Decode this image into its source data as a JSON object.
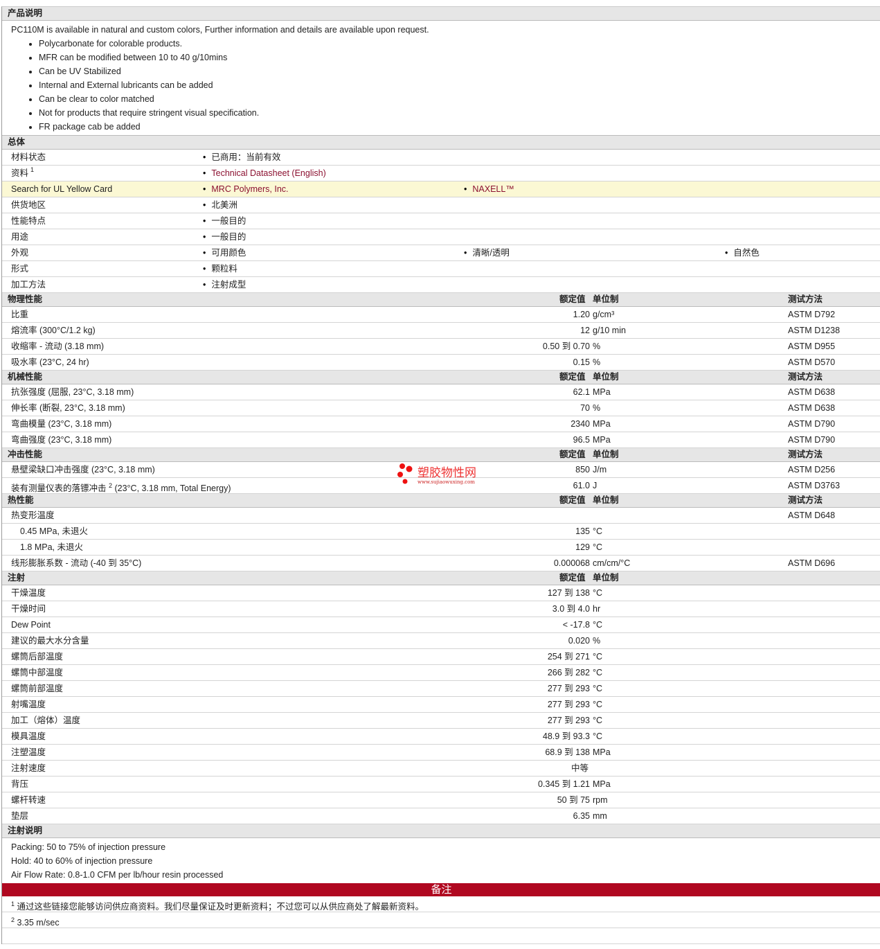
{
  "description": {
    "title": "产品说明",
    "intro": "PC110M is available in natural and custom colors, Further information and details are available upon request.",
    "bullets": [
      "Polycarbonate for colorable products.",
      "MFR can be modified between 10 to 40 g/10mins",
      "Can be UV Stabilized",
      "Internal and External lubricants can be added",
      "Can be clear to color matched",
      "Not for products that require stringent visual specification.",
      "FR package cab be added"
    ]
  },
  "general": {
    "title": "总体",
    "rows": [
      {
        "label": "材料状态",
        "items": [
          "已商用：当前有效"
        ]
      },
      {
        "label": "资料",
        "sup": "1",
        "items": [
          "Technical Datasheet (English)"
        ],
        "link": true
      },
      {
        "label": "Search for UL Yellow Card",
        "items": [
          "MRC Polymers, Inc.",
          "NAXELL™"
        ],
        "link": true,
        "highlight": true
      },
      {
        "label": "供货地区",
        "items": [
          "北美洲"
        ]
      },
      {
        "label": "性能特点",
        "items": [
          "一般目的"
        ]
      },
      {
        "label": "用途",
        "items": [
          "一般目的"
        ]
      },
      {
        "label": "外观",
        "items": [
          "可用颜色",
          "清晰/透明",
          "自然色"
        ]
      },
      {
        "label": "形式",
        "items": [
          "颗粒料"
        ]
      },
      {
        "label": "加工方法",
        "items": [
          "注射成型"
        ]
      }
    ]
  },
  "columns": {
    "nominal": "额定值",
    "unit": "单位制",
    "test": "测试方法"
  },
  "sections": [
    {
      "title": "物理性能",
      "test": true,
      "rows": [
        {
          "label": "比重",
          "value": "1.20",
          "unit": "g/cm³",
          "test": "ASTM D792"
        },
        {
          "label": "熔流率  (300°C/1.2 kg)",
          "value": "12",
          "unit": "g/10 min",
          "test": "ASTM D1238"
        },
        {
          "label": "收缩率  - 流动  (3.18 mm)",
          "value": "0.50 到  0.70",
          "unit": "%",
          "test": "ASTM D955"
        },
        {
          "label": "吸水率  (23°C, 24 hr)",
          "value": "0.15",
          "unit": "%",
          "test": "ASTM D570"
        }
      ]
    },
    {
      "title": "机械性能",
      "test": true,
      "rows": [
        {
          "label": "抗张强度  (屈服, 23°C, 3.18 mm)",
          "value": "62.1",
          "unit": "MPa",
          "test": "ASTM D638"
        },
        {
          "label": "伸长率  (断裂, 23°C, 3.18 mm)",
          "value": "70",
          "unit": "%",
          "test": "ASTM D638"
        },
        {
          "label": "弯曲模量  (23°C, 3.18 mm)",
          "value": "2340",
          "unit": "MPa",
          "test": "ASTM D790"
        },
        {
          "label": "弯曲强度  (23°C, 3.18 mm)",
          "value": "96.5",
          "unit": "MPa",
          "test": "ASTM D790"
        }
      ]
    },
    {
      "title": "冲击性能",
      "test": true,
      "rows": [
        {
          "label": "悬壁梁缺口冲击强度  (23°C, 3.18 mm)",
          "value": "850",
          "unit": "J/m",
          "test": "ASTM D256"
        },
        {
          "label": "装有测量仪表的落镖冲击",
          "sup": "2",
          "label2": " (23°C, 3.18 mm, Total Energy)",
          "value": "61.0",
          "unit": "J",
          "test": "ASTM D3763"
        }
      ]
    },
    {
      "title": "热性能",
      "test": true,
      "rows": [
        {
          "label": "热变形温度",
          "value": "",
          "unit": "",
          "test": "ASTM D648"
        },
        {
          "label": "0.45 MPa, 未退火",
          "indent": true,
          "value": "135",
          "unit": "°C",
          "test": ""
        },
        {
          "label": "1.8 MPa, 未退火",
          "indent": true,
          "value": "129",
          "unit": "°C",
          "test": ""
        },
        {
          "label": "线形膨胀系数  - 流动  (-40 到  35°C)",
          "value": "0.000068",
          "unit": "cm/cm/°C",
          "test": "ASTM D696"
        }
      ]
    },
    {
      "title": "注射",
      "test": false,
      "rows": [
        {
          "label": "干燥温度",
          "value": "127 到  138",
          "unit": "°C"
        },
        {
          "label": "干燥时间",
          "value": "3.0 到  4.0",
          "unit": "hr"
        },
        {
          "label": "Dew Point",
          "value": "< -17.8",
          "unit": "°C"
        },
        {
          "label": "建议的最大水分含量",
          "value": "0.020",
          "unit": "%"
        },
        {
          "label": "螺筒后部温度",
          "value": "254 到  271",
          "unit": "°C"
        },
        {
          "label": "螺筒中部温度",
          "value": "266 到  282",
          "unit": "°C"
        },
        {
          "label": "螺筒前部温度",
          "value": "277 到  293",
          "unit": "°C"
        },
        {
          "label": "射嘴温度",
          "value": "277 到  293",
          "unit": "°C"
        },
        {
          "label": "加工（熔体）温度",
          "value": "277 到  293",
          "unit": "°C"
        },
        {
          "label": "模具温度",
          "value": "48.9 到  93.3",
          "unit": "°C"
        },
        {
          "label": "注塑温度",
          "value": "68.9 到  138",
          "unit": "MPa"
        },
        {
          "label": "注射速度",
          "value": "",
          "unit": "中等"
        },
        {
          "label": "背压",
          "value": "0.345 到  1.21",
          "unit": "MPa"
        },
        {
          "label": "螺杆转速",
          "value": "50 到  75",
          "unit": "rpm"
        },
        {
          "label": "垫层",
          "value": "6.35",
          "unit": "mm"
        }
      ]
    }
  ],
  "injection_notes": {
    "title": "注射说明",
    "lines": [
      "Packing: 50 to 75% of injection pressure",
      "Hold: 40 to 60% of injection pressure",
      "Air Flow Rate: 0.8-1.0 CFM per lb/hour resin processed"
    ]
  },
  "remarks": {
    "title": "备注",
    "notes": [
      {
        "sup": "1",
        "text": "通过这些链接您能够访问供应商资料。我们尽量保证及时更新资料；不过您可以从供应商处了解最新资料。"
      },
      {
        "sup": "2",
        "text": "3.35 m/sec"
      }
    ]
  },
  "watermark": {
    "name": "塑胶物性网",
    "url": "www.sujiaowuxing.com"
  }
}
